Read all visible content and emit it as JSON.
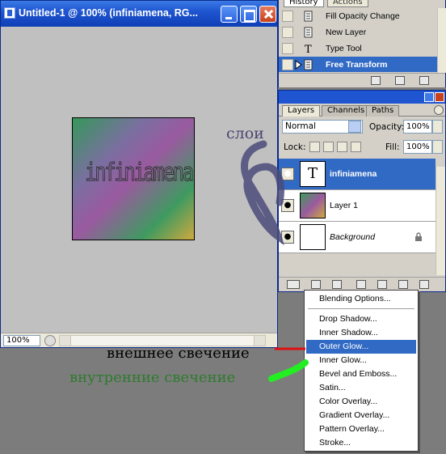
{
  "document_window": {
    "title": "Untitled-1 @ 100% (infiniamena, RG...",
    "artwork_text": "infiniamena",
    "zoom": "100%"
  },
  "history_panel": {
    "tabs": [
      "History",
      "Actions"
    ],
    "items": [
      {
        "label": "Fill Opacity Change",
        "icon": "history-state-icon",
        "selected": false
      },
      {
        "label": "New Layer",
        "icon": "history-state-icon",
        "selected": false
      },
      {
        "label": "Type Tool",
        "icon": "type-tool-icon",
        "selected": false
      },
      {
        "label": "Free Transform",
        "icon": "history-state-icon",
        "selected": true
      }
    ]
  },
  "layers_panel": {
    "tabs": [
      "Layers",
      "Channels",
      "Paths"
    ],
    "blend_mode": "Normal",
    "opacity_label": "Opacity:",
    "opacity_value": "100%",
    "lock_label": "Lock:",
    "fill_label": "Fill:",
    "fill_value": "100%",
    "layers": [
      {
        "name": "infiniamena",
        "type": "text",
        "selected": true,
        "visible": true
      },
      {
        "name": "Layer 1",
        "type": "gradient",
        "selected": false,
        "visible": true
      },
      {
        "name": "Background",
        "type": "background",
        "selected": false,
        "visible": true,
        "locked": true
      }
    ]
  },
  "layer_style_menu": {
    "items": [
      "Blending Options...",
      "Drop Shadow...",
      "Inner Shadow...",
      "Outer Glow...",
      "Inner Glow...",
      "Bevel and Emboss...",
      "Satin...",
      "Color Overlay...",
      "Gradient Overlay...",
      "Pattern Overlay...",
      "Stroke..."
    ],
    "highlighted": "Outer Glow..."
  },
  "annotations": {
    "layers_label": "слои",
    "outer_glow_label": "внешнее свечение",
    "inner_glow_label": "внутренние свечение"
  },
  "colors": {
    "selection": "#316ac5",
    "titlebar": "#1f55d0",
    "annotation_red": "#e01010",
    "annotation_green": "#22ee22",
    "annotation_scribble": "#4a4a7a"
  }
}
